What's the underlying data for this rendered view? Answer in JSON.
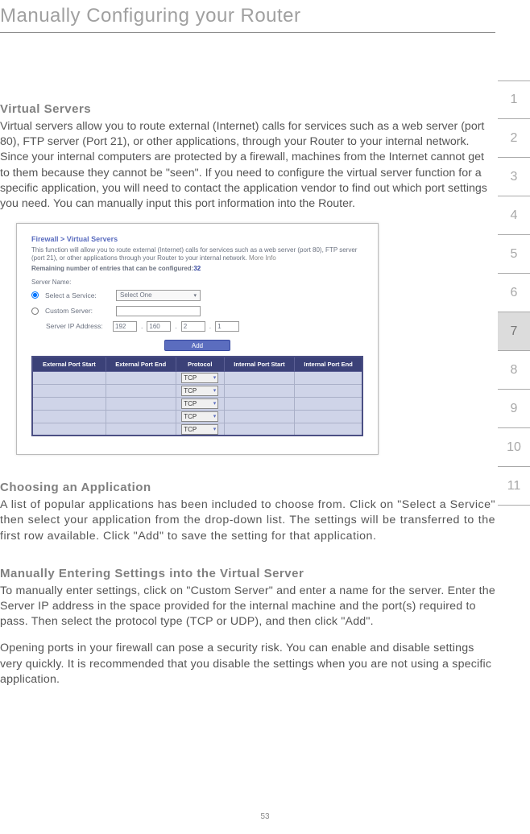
{
  "page_title": "Manually Configuring your Router",
  "side_tabs": [
    "1",
    "2",
    "3",
    "4",
    "5",
    "6",
    "7",
    "8",
    "9",
    "10",
    "11"
  ],
  "active_tab_index": 6,
  "page_number": "53",
  "section1": {
    "heading": "Virtual Servers",
    "body": "Virtual servers allow you to route external (Internet) calls for services such as a web server (port 80), FTP server (Port 21), or other applications, through your Router to your internal network. Since your internal computers are protected by a firewall, machines from the Internet cannot get to them because they cannot be \"seen\". If you need to configure the virtual server function for a specific application, you will need to contact the application vendor to find out which port settings you need. You can manually input this port information into the Router."
  },
  "screenshot": {
    "breadcrumb": "Firewall > Virtual Servers",
    "description": "This function will allow you to route external (Internet) calls for services such as a web server (port 80), FTP server (port 21), or other applications through your Router to your internal network.",
    "more_info": "More Info",
    "remaining_label": "Remaining number of entries that can be configured:",
    "remaining_value": "32",
    "server_name_label": "Server Name:",
    "select_service_label": "Select a Service:",
    "select_service_value": "Select One",
    "custom_server_label": "Custom Server:",
    "ip_label": "Server IP Address:",
    "ip_parts": [
      "192",
      "160",
      "2",
      "1"
    ],
    "add_button": "Add",
    "table_headers": [
      "External Port Start",
      "External Port End",
      "Protocol",
      "Internal Port Start",
      "Internal Port End"
    ],
    "protocol_value": "TCP",
    "row_count": 5
  },
  "section2": {
    "heading": "Choosing an Application",
    "body": "A list of popular applications has been included to choose from. Click on \"Select a Service\" then select your application from the drop-down list. The settings will be transferred to the first row available. Click \"Add\" to save the setting for that application."
  },
  "section3": {
    "heading": "Manually Entering Settings into the Virtual Server",
    "body1": "To manually enter settings, click on \"Custom Server\" and enter a name for the server. Enter the Server IP address in the space provided for the internal machine and the port(s) required to pass. Then select the protocol type (TCP or UDP), and then click \"Add\".",
    "body2": "Opening ports in your firewall can pose a security risk. You can enable and disable settings very quickly. It is recommended that you disable the settings when you are not using a specific application."
  }
}
